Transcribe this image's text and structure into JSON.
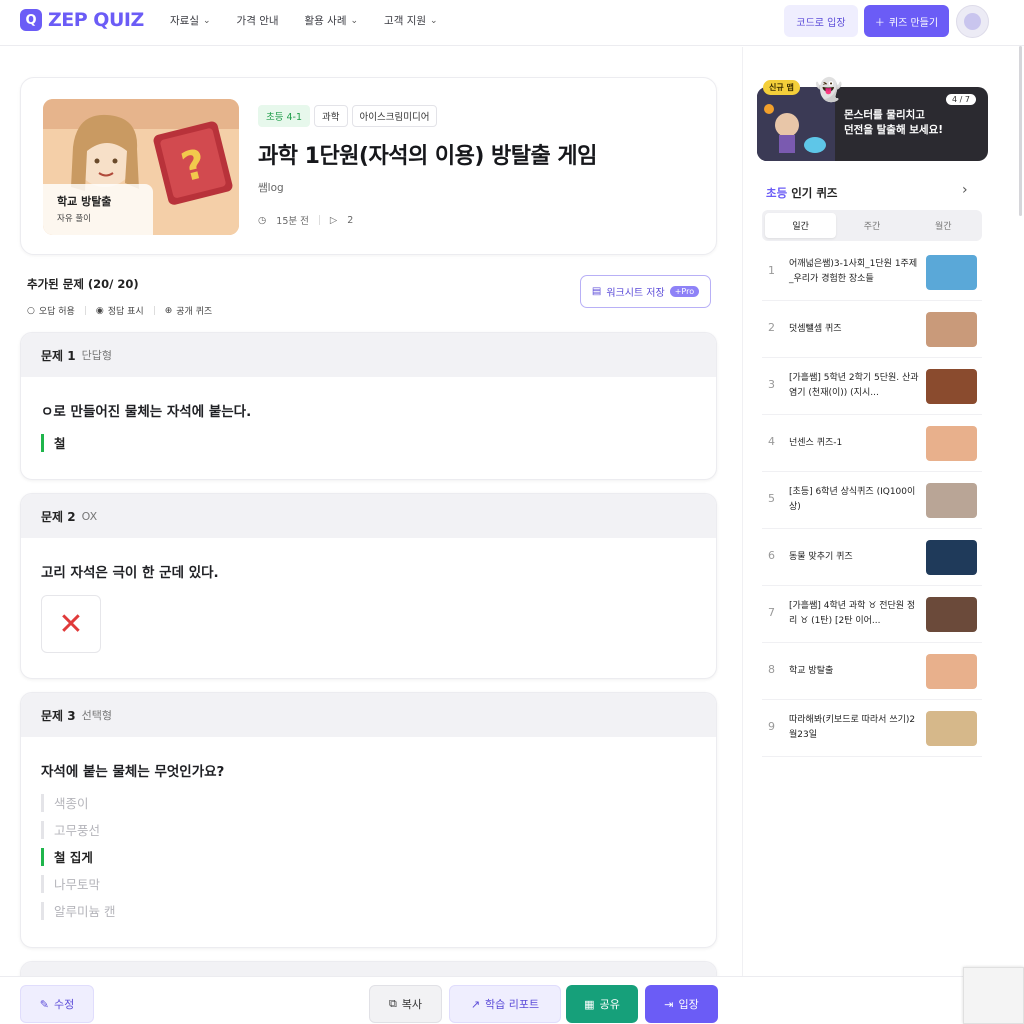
{
  "nav": {
    "logo": "ZEP QUIZ",
    "logo_mark": "Q",
    "menu": [
      {
        "label": "자료실",
        "dropdown": true
      },
      {
        "label": "가격 안내",
        "dropdown": false
      },
      {
        "label": "활용 사례",
        "dropdown": true
      },
      {
        "label": "고객 지원",
        "dropdown": true
      }
    ],
    "code_enter": "코드로 입장",
    "make_quiz": "퀴즈 만들기"
  },
  "quiz": {
    "thumb_title": "학교 방탈출",
    "thumb_sub": "자유 풀이",
    "tags": [
      {
        "label": "초등 4-1",
        "style": "green"
      },
      {
        "label": "과학",
        "style": "plain"
      },
      {
        "label": "아이스크림미디어",
        "style": "plain"
      }
    ],
    "title": "과학 1단원(자석의 이용) 방탈출 게임",
    "author": "쌤log",
    "time_ago": "15분 전",
    "plays": "2"
  },
  "summary": {
    "added": "추가된 문제 (20/ 20)",
    "options": [
      "오답 허용",
      "정답 표시",
      "공개 퀴즈"
    ],
    "worksheet_btn": "워크시트 저장",
    "pro": "+Pro"
  },
  "questions": [
    {
      "num": "문제 1",
      "type": "단답형",
      "text": "ㅇ로 만들어진 물체는 자석에 붙는다.",
      "answers": [
        {
          "text": "철",
          "correct": true
        }
      ]
    },
    {
      "num": "문제 2",
      "type": "OX",
      "text": "고리 자석은 극이 한 군데 있다.",
      "ox": "✕"
    },
    {
      "num": "문제 3",
      "type": "선택형",
      "text": "자석에 붙는 물체는 무엇인가요?",
      "answers": [
        {
          "text": "색종이",
          "correct": false
        },
        {
          "text": "고무풍선",
          "correct": false
        },
        {
          "text": "철 집게",
          "correct": true
        },
        {
          "text": "나무토막",
          "correct": false
        },
        {
          "text": "알루미늄 캔",
          "correct": false
        }
      ]
    }
  ],
  "bottom": {
    "edit": "수정",
    "copy": "복사",
    "report": "학습 리포트",
    "share": "공유",
    "enter": "입장"
  },
  "sidebar": {
    "banner_badge": "신규 맵",
    "banner_line1": "몬스터를 물리치고",
    "banner_line2": "던전을 탈출해 보세요!",
    "banner_count": "4 / 7",
    "popular_prefix": "초등",
    "popular_title": "인기 퀴즈",
    "periods": [
      "일간",
      "주간",
      "월간"
    ],
    "active_period": 0,
    "ranking": [
      {
        "rank": "1",
        "title": "어깨넓은쌤)3-1사회_1단원 1주제_우리가 경험한 장소들",
        "color": "#5aa8d8"
      },
      {
        "rank": "2",
        "title": "덧셈뺄셈 퀴즈",
        "color": "#c99a7a"
      },
      {
        "rank": "3",
        "title": "[가흘쌤] 5학년 2학기 5단원. 산과 염기 (천재(이)) (지시...",
        "color": "#8a4b2e"
      },
      {
        "rank": "4",
        "title": "넌센스 퀴즈-1",
        "color": "#e8b08c"
      },
      {
        "rank": "5",
        "title": "[초등] 6학년 상식퀴즈 (IQ100이상)",
        "color": "#b9a596"
      },
      {
        "rank": "6",
        "title": "동물 맞추기 퀴즈",
        "color": "#1f3a5a"
      },
      {
        "rank": "7",
        "title": "[가흘쌤] 4학년 과학 ♉ 전단원 정리 ♉ (1탄) [2탄 이어...",
        "color": "#6b4a3a"
      },
      {
        "rank": "8",
        "title": "학교 방탈출",
        "color": "#e8b08c"
      },
      {
        "rank": "9",
        "title": "따라해봐(키보드로 따라서 쓰기)2월23일",
        "color": "#d6b88a"
      }
    ]
  }
}
